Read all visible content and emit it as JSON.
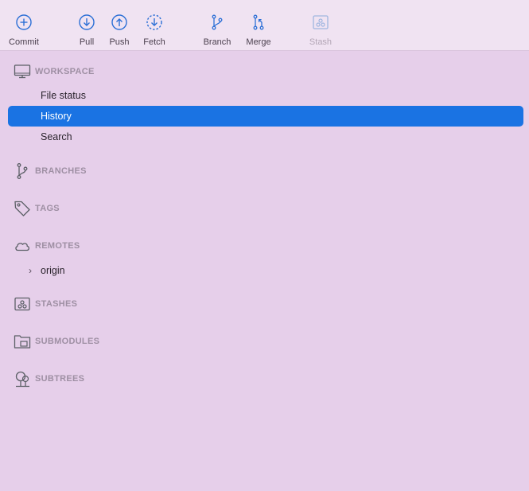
{
  "toolbar": {
    "buttons": [
      {
        "label": "Commit",
        "icon": "commit-icon"
      },
      {
        "label": "Pull",
        "icon": "pull-icon"
      },
      {
        "label": "Push",
        "icon": "push-icon"
      },
      {
        "label": "Fetch",
        "icon": "fetch-icon"
      },
      {
        "label": "Branch",
        "icon": "branch-icon"
      },
      {
        "label": "Merge",
        "icon": "merge-icon"
      },
      {
        "label": "Stash",
        "icon": "stash-icon",
        "disabled": true
      }
    ]
  },
  "sidebar": {
    "workspace": {
      "header": "WORKSPACE",
      "items": [
        {
          "label": "File status"
        },
        {
          "label": "History",
          "selected": true
        },
        {
          "label": "Search"
        }
      ]
    },
    "branches": {
      "header": "BRANCHES"
    },
    "tags": {
      "header": "TAGS"
    },
    "remotes": {
      "header": "REMOTES",
      "items": [
        {
          "label": "origin",
          "expandable": true
        }
      ]
    },
    "stashes": {
      "header": "STASHES"
    },
    "submodules": {
      "header": "SUBMODULES"
    },
    "subtrees": {
      "header": "SUBTREES"
    }
  },
  "colors": {
    "accent": "#1a73e3",
    "background": "#e6cfea",
    "toolbar_background": "#f0e3f2",
    "section_header": "#9e8fa3",
    "icon_stroke": "#2b6fd6"
  }
}
